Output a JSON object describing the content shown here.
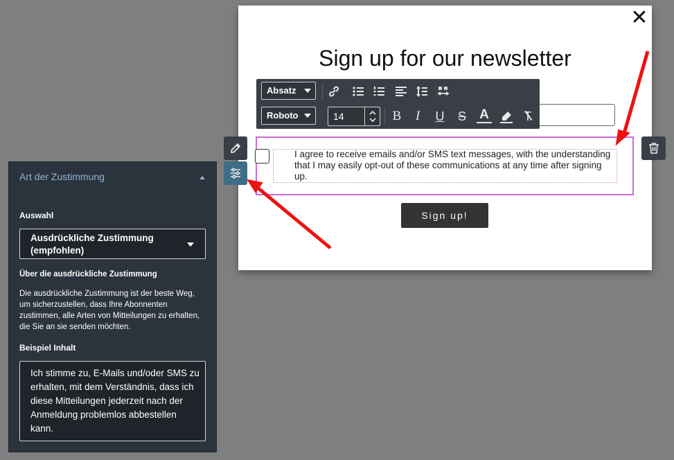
{
  "modal": {
    "close_label": "✕",
    "title": "Sign up for our newsletter",
    "consent_text": "I agree to receive emails and/or SMS text messages, with the understanding that I may easily opt-out of these communications at any time after signing up.",
    "signup_label": "Sign up!"
  },
  "toolbar": {
    "block_type": "Absatz",
    "font_family": "Roboto",
    "font_size": "14",
    "icons": [
      "link-icon",
      "bullet-list-icon",
      "numbered-list-icon",
      "align-left-icon",
      "line-height-icon",
      "text-direction-icon",
      "bold-icon",
      "italic-icon",
      "underline-icon",
      "strikethrough-icon",
      "text-color-icon",
      "highlight-icon",
      "clear-format-icon"
    ],
    "bold": "B",
    "italic": "I",
    "underline": "U",
    "strike": "S",
    "text_color": "A",
    "clear_format": "T"
  },
  "side_buttons": {
    "edit": "pencil-icon",
    "settings": "sliders-icon",
    "delete": "trash-icon"
  },
  "panel": {
    "header": "Art der Zustimmung",
    "selection_label": "Auswahl",
    "selection_value": "Ausdrückliche Zustimmung (empfohlen)",
    "about_title": "Über die ausdrückliche Zustimmung",
    "about_text": "Die ausdrückliche Zustimmung ist der beste Weg, um sicherzustellen, dass Ihre Abonnenten zustimmen, alle Arten von Mitteilungen zu erhalten, die Sie an sie senden möchten.",
    "example_label": "Beispiel Inhalt",
    "example_text": "Ich stimme zu, E-Mails und/oder SMS zu erhalten, mit dem Verständnis, dass ich diese Mitteilungen jederzeit nach der Anmeldung problemlos abbestellen kann."
  },
  "colors": {
    "background": "#7f7f7f",
    "panel_bg": "#2b333c",
    "panel_header": "#8fb5d6",
    "highlight_border": "#c86ad0",
    "settings_button": "#3d6e86",
    "arrow": "#ee1111"
  }
}
